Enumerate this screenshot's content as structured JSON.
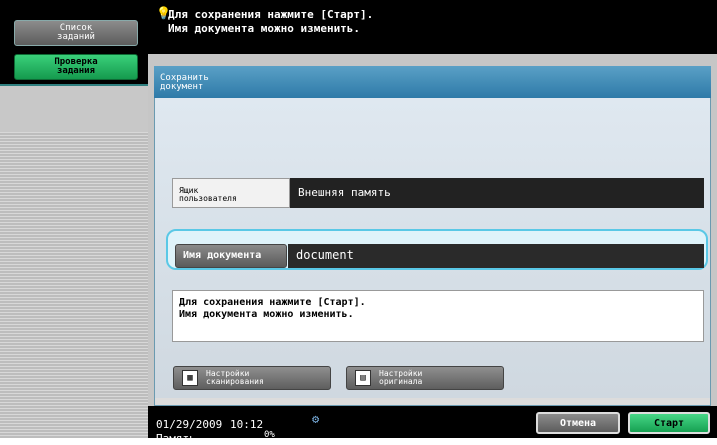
{
  "sidebar": {
    "job_list": "Список\nзаданий",
    "job_check": "Проверка\nзадания"
  },
  "message": {
    "line1": "Для сохранения нажмите [Старт].",
    "line2": "Имя документа можно изменить."
  },
  "panel": {
    "title": "Сохранить\nдокумент",
    "user_box_label": "Ящик\nпользователя",
    "user_box_value": "Внешняя память",
    "doc_name_label": "Имя документа",
    "doc_name_value": "document",
    "info_line1": "Для сохранения нажмите [Старт].",
    "info_line2": "Имя документа можно изменить."
  },
  "tools": {
    "scan_settings": "Настройки\nсканирования",
    "original_settings": "Настройки\nоригинала"
  },
  "status": {
    "date": "01/29/2009",
    "time": "10:12",
    "memory": "Память",
    "percent": "0%"
  },
  "controls": {
    "cancel": "Отмена",
    "start": "Старт"
  }
}
